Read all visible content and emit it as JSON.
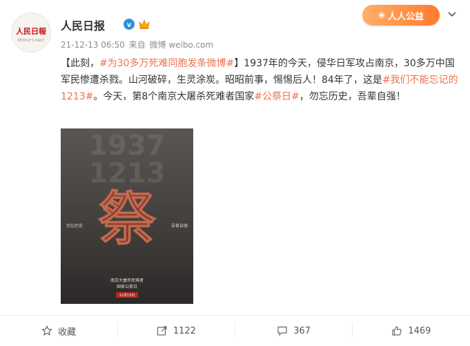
{
  "user": {
    "name": "人民日报",
    "avatar_text": "人民日報",
    "avatar_subtext": "PEOPLE'S DAILY"
  },
  "meta": {
    "time": "21-12-13 06:50",
    "source_prefix": "来自",
    "source": "微博 weibo.com"
  },
  "badge": {
    "label": "人人公益"
  },
  "post": {
    "text_1": "【此刻，",
    "tag_1": "#为30多万死难同胞发条微博#",
    "text_2": "】1937年的今天，侵华日军攻占南京，30多万中国军民惨遭杀戮。山河破碎，生灵涂炭。昭昭前事，惕惕后人！84年了，这是",
    "tag_2": "#我们不能忘记的1213#",
    "text_3": "。今天，第8个南京大屠杀死难者国家",
    "tag_3": "#公祭日#",
    "text_4": "，勿忘历史，吾辈自强！"
  },
  "poster": {
    "big_char": "祭",
    "numbers_top": "1937",
    "numbers_mid": "1213",
    "left_caption": "勿忘历史",
    "right_caption": "吾辈自强",
    "bottom_line_1": "南京大屠杀死难者",
    "bottom_line_2": "国家公祭日",
    "date_label": "12月13日"
  },
  "actions": {
    "favorite_label": "收藏",
    "repost_count": "1122",
    "comment_count": "367",
    "like_count": "1469"
  },
  "colors": {
    "tag": "#eb7350",
    "badge": "#ff8a3d",
    "text": "#333333",
    "meta": "#8d8d8d"
  }
}
